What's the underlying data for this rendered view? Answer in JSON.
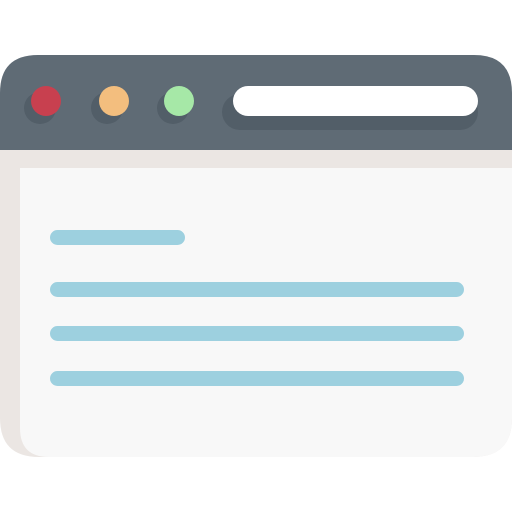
{
  "window": {
    "title": "",
    "controls": [
      {
        "name": "close",
        "color": "#c8404f"
      },
      {
        "name": "minimize",
        "color": "#f3be7e"
      },
      {
        "name": "maximize",
        "color": "#a6e8a7"
      }
    ],
    "address_bar": {
      "value": "",
      "background": "#ffffff"
    }
  },
  "content": {
    "text_lines": [
      {
        "type": "heading"
      },
      {
        "type": "paragraph-line"
      },
      {
        "type": "paragraph-line"
      },
      {
        "type": "paragraph-line"
      }
    ]
  },
  "colors": {
    "title_bar": "#5f6b75",
    "title_bar_shadow": "#525e68",
    "frame_shadow": "#ebe6e3",
    "content_background": "#f8f8f8",
    "text_placeholder": "#9dd0df"
  }
}
